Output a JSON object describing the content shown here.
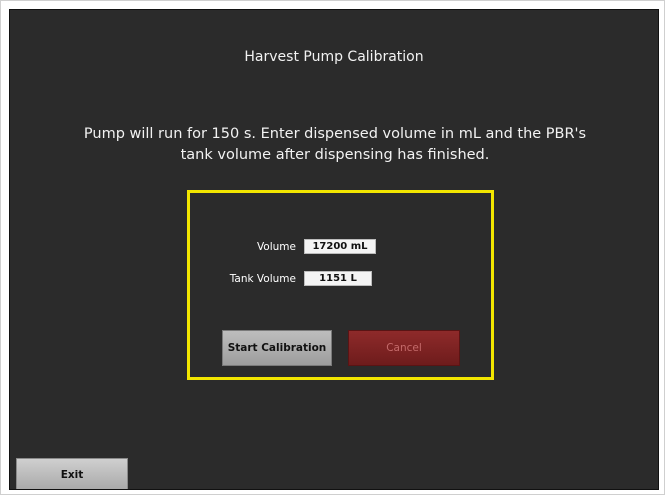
{
  "screen": {
    "title": "Harvest Pump Calibration",
    "instructions": "Pump will run for 150 s. Enter dispensed volume in mL and the PBR's tank volume after dispensing has finished."
  },
  "form": {
    "volume_label": "Volume",
    "volume_value": "17200 mL",
    "tank_volume_label": "Tank Volume",
    "tank_volume_value": "1151 L"
  },
  "buttons": {
    "start_calibration": "Start Calibration",
    "cancel": "Cancel",
    "exit": "Exit"
  },
  "colors": {
    "background": "#2b2b2b",
    "panel_border": "#f2e600",
    "cancel_button": "#7e2222",
    "neutral_button": "#b0b0b0"
  }
}
